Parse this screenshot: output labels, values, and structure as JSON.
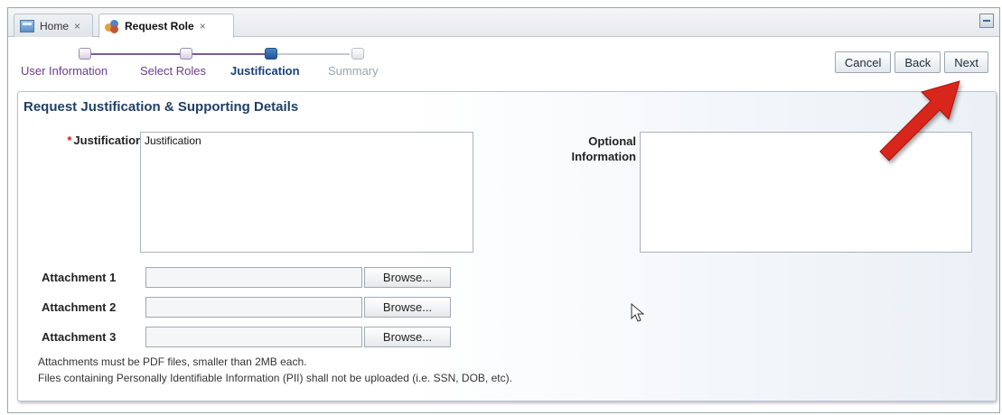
{
  "tabs": [
    {
      "label": "Home",
      "close": "×"
    },
    {
      "label": "Request Role",
      "close": "×"
    }
  ],
  "train": {
    "steps": [
      {
        "label": "User Information",
        "state": "visited"
      },
      {
        "label": "Select Roles",
        "state": "visited"
      },
      {
        "label": "Justification",
        "state": "current"
      },
      {
        "label": "Summary",
        "state": "future"
      }
    ]
  },
  "toolbar": {
    "cancel_label": "Cancel",
    "back_label": "Back",
    "next_label": "Next"
  },
  "panel": {
    "title": "Request Justification & Supporting Details",
    "justification": {
      "required_marker": "*",
      "label": "Justification",
      "value": "Justification"
    },
    "optional": {
      "label_line1": "Optional",
      "label_line2": "Information",
      "value": ""
    },
    "attachments": [
      {
        "label": "Attachment 1",
        "value": "",
        "browse_label": "Browse..."
      },
      {
        "label": "Attachment 2",
        "value": "",
        "browse_label": "Browse..."
      },
      {
        "label": "Attachment 3",
        "value": "",
        "browse_label": "Browse..."
      }
    ],
    "notes": [
      "Attachments must be PDF files, smaller than 2MB each.",
      "Files containing Personally Identifiable Information (PII) shall not be uploaded (i.e. SSN, DOB, etc)."
    ]
  },
  "icons": {
    "home_tab": "home-icon",
    "request_tab": "role-icon",
    "corner": "restore-window-icon",
    "pointer": "mouse-pointer-icon",
    "annotation": "red-arrow-icon"
  },
  "colors": {
    "visited_step": "#6a3d8c",
    "current_step": "#1a3f7a",
    "future_step": "#9aa4ae",
    "required": "#c4281c",
    "title": "#1f3f66",
    "annotation_arrow": "#d8261f"
  }
}
